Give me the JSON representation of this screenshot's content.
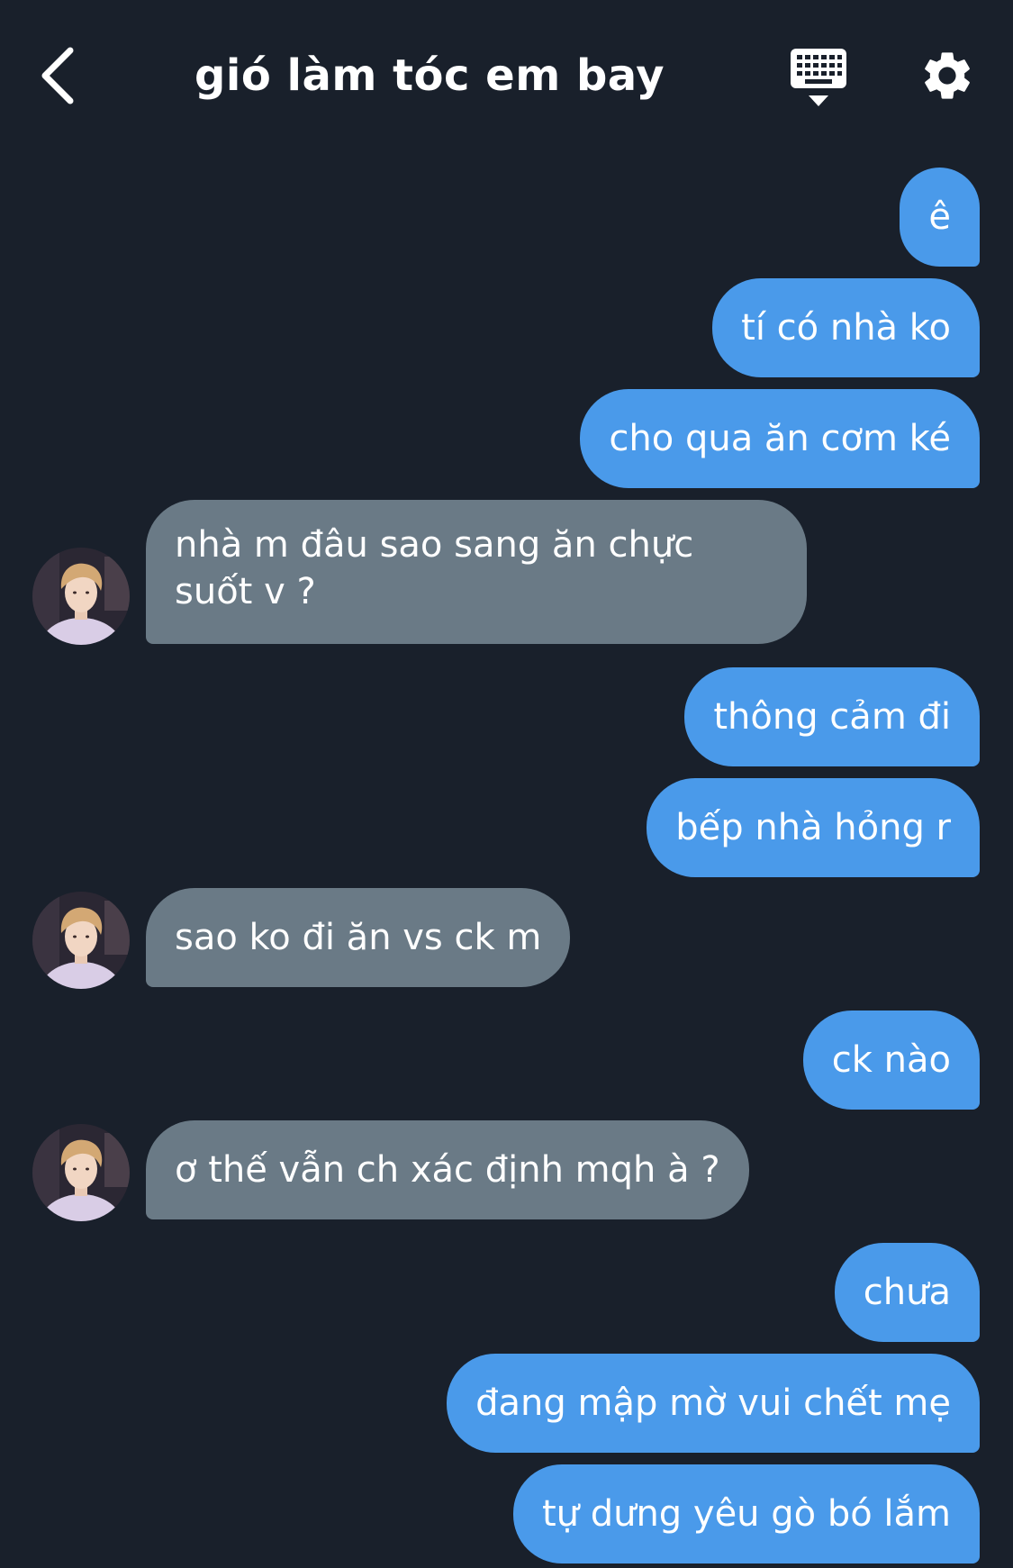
{
  "header": {
    "title": "gió làm tóc em bay",
    "back_icon": "chevron-left-icon",
    "keyboard_icon": "keyboard-icon",
    "settings_icon": "gear-icon"
  },
  "colors": {
    "background": "#19202b",
    "outgoing_bubble": "#4a9aea",
    "incoming_bubble": "#6a7a86",
    "text": "#ffffff"
  },
  "messages": [
    {
      "side": "out",
      "text": "ê"
    },
    {
      "side": "out",
      "text": "tí có nhà ko"
    },
    {
      "side": "out",
      "text": "cho qua ăn cơm ké"
    },
    {
      "side": "in",
      "text": "nhà m đâu sao sang ăn chực suốt v ?"
    },
    {
      "side": "out",
      "text": "thông cảm đi"
    },
    {
      "side": "out",
      "text": "bếp nhà hỏng r"
    },
    {
      "side": "in",
      "text": "sao ko đi ăn vs ck m"
    },
    {
      "side": "out",
      "text": "ck nào"
    },
    {
      "side": "in",
      "text": "ơ thế vẫn ch xác định mqh à ?"
    },
    {
      "side": "out",
      "text": "chưa"
    },
    {
      "side": "out",
      "text": "đang mập mờ vui chết mẹ"
    },
    {
      "side": "out",
      "text": "tự dưng yêu gò bó lắm"
    }
  ]
}
